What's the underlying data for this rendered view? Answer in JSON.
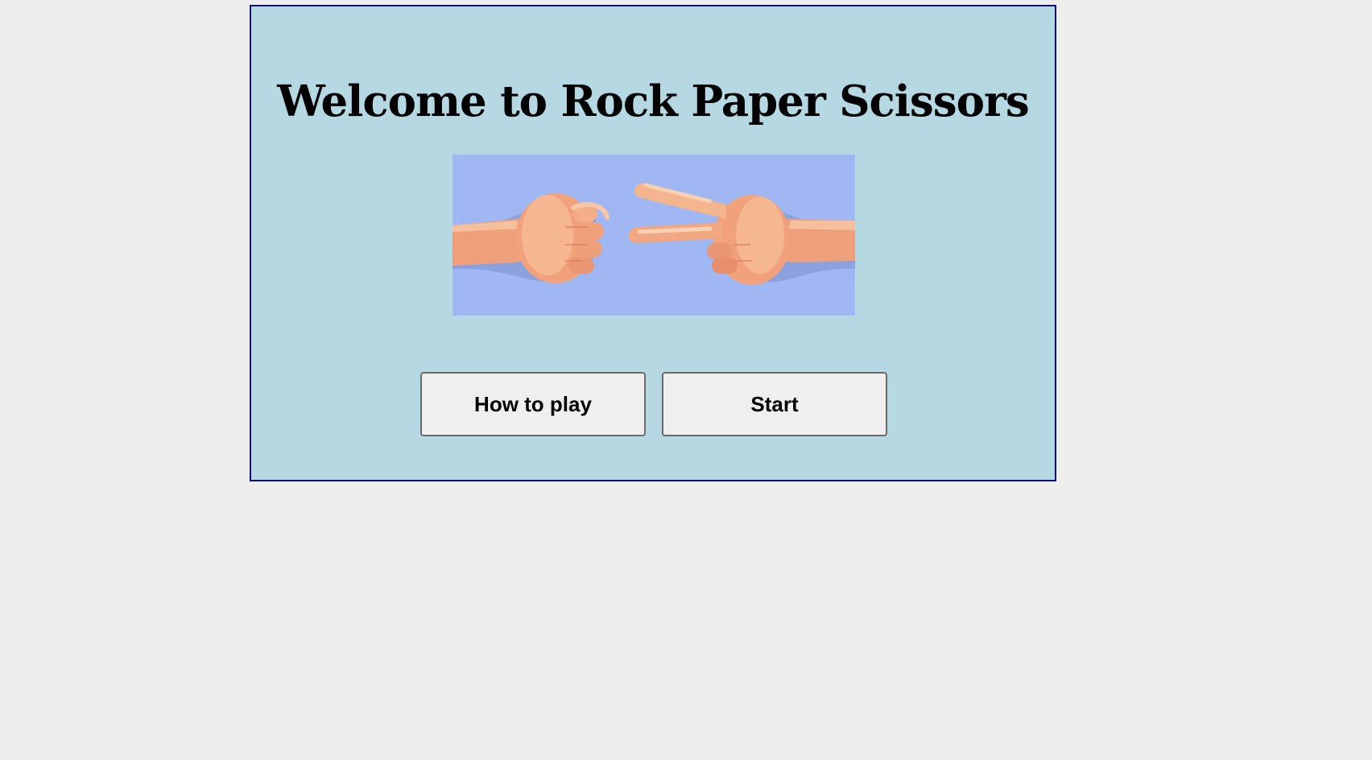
{
  "game": {
    "title": "Welcome to Rock Paper Scissors",
    "hero_image": "rock-vs-scissors-hands",
    "buttons": {
      "how_to_play": "How to play",
      "start": "Start"
    }
  },
  "colors": {
    "page_background": "#eeeeee",
    "panel_background": "#b5d8e3",
    "panel_border": "#0b0f6e",
    "hero_background": "#9fb7f2",
    "button_background": "#efefef"
  }
}
